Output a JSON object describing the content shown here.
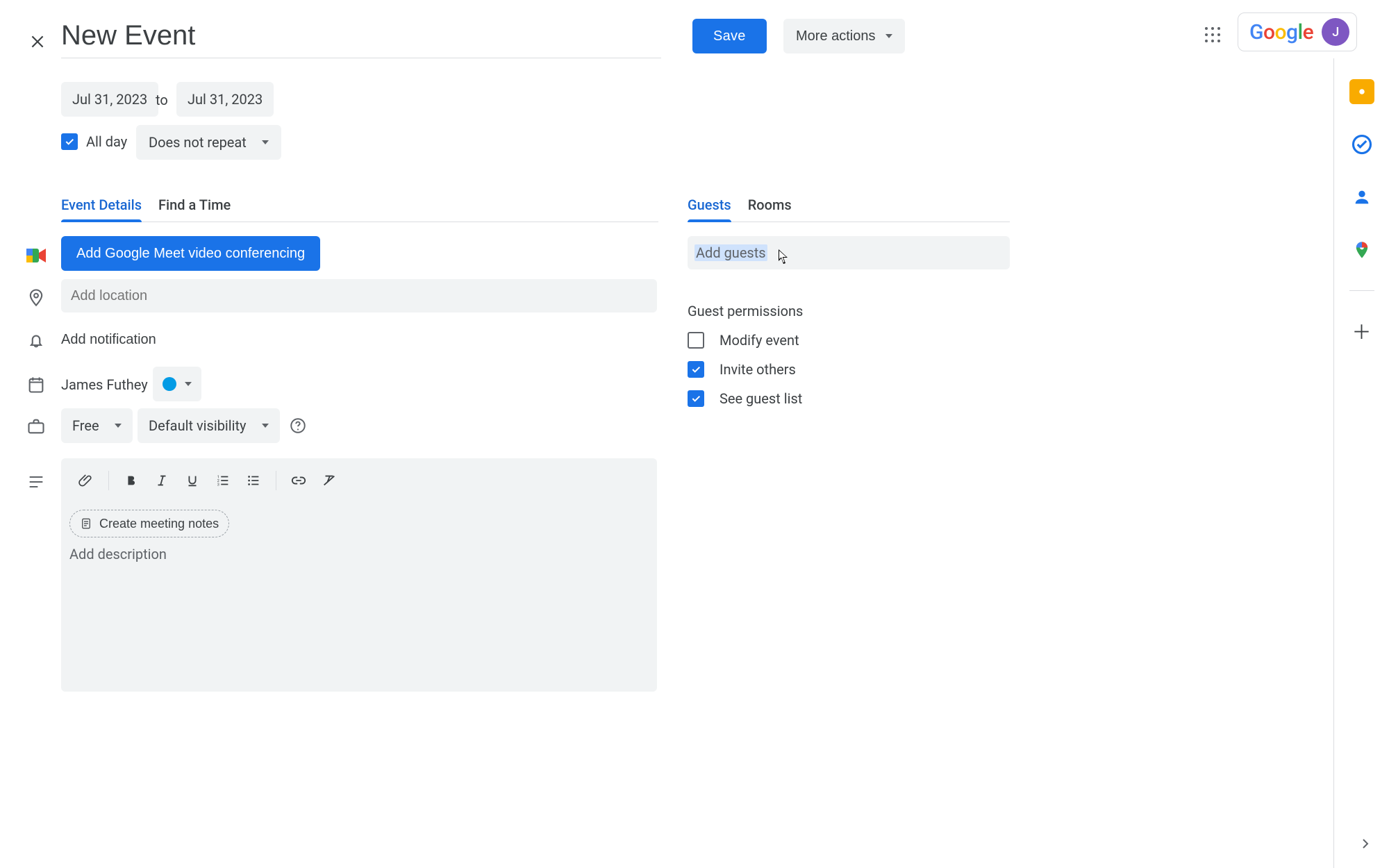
{
  "title": "New Event",
  "save_label": "Save",
  "more_actions_label": "More actions",
  "brand": "Google",
  "avatar_initial": "J",
  "dates": {
    "start": "Jul 31, 2023",
    "to": "to",
    "end": "Jul 31, 2023"
  },
  "allday": {
    "checked": true,
    "label": "All day"
  },
  "repeat_label": "Does not repeat",
  "tabs_left": {
    "event_details": "Event Details",
    "find_a_time": "Find a Time"
  },
  "meet_button": "Add Google Meet video conferencing",
  "location_placeholder": "Add location",
  "notification_label": "Add notification",
  "owner_name": "James Futhey",
  "calendar_color": "#039be5",
  "availability": "Free",
  "visibility": "Default visibility",
  "meeting_notes": "Create meeting notes",
  "description_placeholder": "Add description",
  "tabs_right": {
    "guests": "Guests",
    "rooms": "Rooms"
  },
  "guests_placeholder": "Add guests",
  "guest_permissions": {
    "header": "Guest permissions",
    "modify": {
      "label": "Modify event",
      "checked": false
    },
    "invite": {
      "label": "Invite others",
      "checked": true
    },
    "see": {
      "label": "See guest list",
      "checked": true
    }
  },
  "side_panel": {
    "keep": "keep-icon",
    "tasks": "tasks-icon",
    "contacts": "contacts-icon",
    "maps": "maps-icon",
    "addons": "addons-plus-icon",
    "hide": "hide-side-panel-icon"
  }
}
